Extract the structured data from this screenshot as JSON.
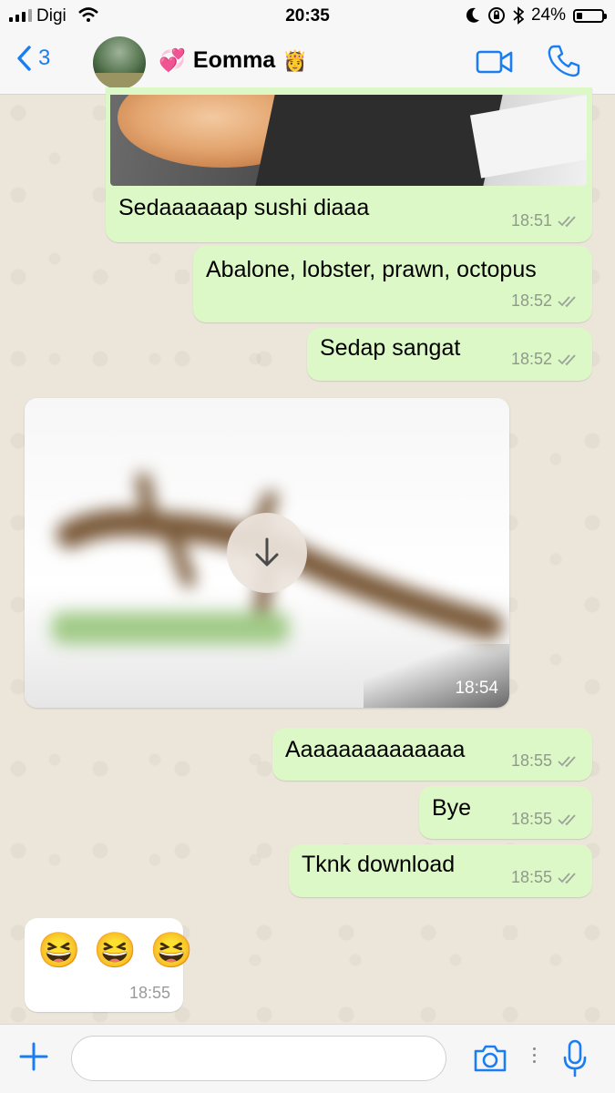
{
  "status_bar": {
    "carrier": "Digi",
    "time": "20:35",
    "battery": "24%",
    "battery_level": 0.24
  },
  "header": {
    "back_count": "3",
    "contact_name": "Eomma",
    "icons": [
      "back-chevron-icon",
      "sparkling-heart-icon",
      "princess-icon",
      "video-call-icon",
      "phone-call-icon"
    ]
  },
  "messages": [
    {
      "type": "image-partial",
      "direction": "out"
    },
    {
      "direction": "out",
      "text": "Sedaaaaaap sushi diaaa",
      "time": "18:51",
      "read": true
    },
    {
      "direction": "out",
      "text": "Abalone, lobster, prawn, octopus",
      "time": "18:52",
      "read": true
    },
    {
      "direction": "out",
      "text": "Sedap sangat",
      "time": "18:52",
      "read": true
    },
    {
      "direction": "in",
      "type": "image-download",
      "time": "18:54"
    },
    {
      "direction": "out",
      "text": "Aaaaaaaaaaaaaa",
      "time": "18:55",
      "read": true
    },
    {
      "direction": "out",
      "text": "Bye",
      "time": "18:55",
      "read": true
    },
    {
      "direction": "out",
      "text": "Tknk download",
      "time": "18:55",
      "read": true
    },
    {
      "direction": "in",
      "text": "😆 😆 😆",
      "time": "18:55"
    }
  ],
  "colors": {
    "accent": "#1a7ef2",
    "outgoing_bubble": "#dcf8c6",
    "incoming_bubble": "#ffffff",
    "read_ticks": "#8f9a8a"
  },
  "input_bar": {
    "placeholder": ""
  }
}
